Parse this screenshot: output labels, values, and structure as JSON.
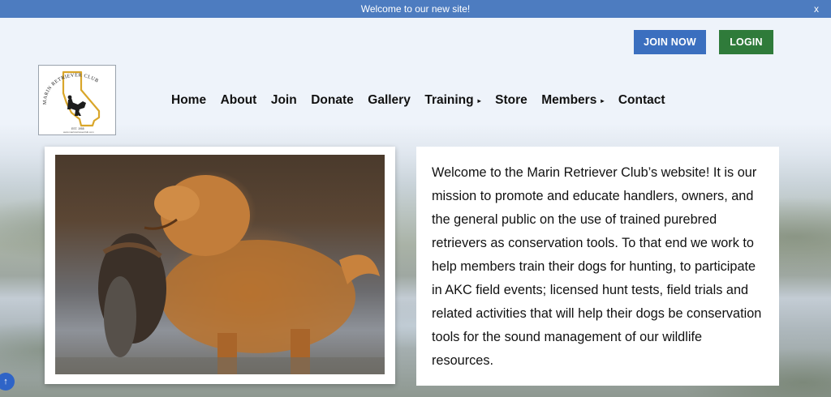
{
  "announcement": {
    "text": "Welcome to our new site!",
    "close": "x"
  },
  "header": {
    "join_label": "JOIN NOW",
    "login_label": "LOGIN",
    "logo": {
      "text": "MARIN RETRIEVER CLUB",
      "est": "EST. 1955",
      "url": "www.marinretrieverclub.com"
    }
  },
  "nav": {
    "items": [
      {
        "label": "Home"
      },
      {
        "label": "About"
      },
      {
        "label": "Join"
      },
      {
        "label": "Donate"
      },
      {
        "label": "Gallery"
      },
      {
        "label": "Training",
        "caret": "▸"
      },
      {
        "label": "Store"
      },
      {
        "label": "Members",
        "caret": "▸"
      },
      {
        "label": "Contact"
      }
    ]
  },
  "main": {
    "welcome_text": "Welcome to the Marin Retriever Club’s website! It is our mission to promote and educate handlers, owners, and the general public on the use of trained purebred retrievers as conservation tools. To that end we work to help members train their dogs for hunting, to participate in AKC field events; licensed hunt tests, field trials and related activities that will help their dogs be conservation tools for the sound management of our wildlife resources."
  },
  "colors": {
    "topbar": "#4d7cc0",
    "join": "#3b6fbf",
    "login": "#2f7b3a",
    "scroll": "#2f64c7"
  },
  "icons": {
    "scroll_top": "arrow-up-icon",
    "photo": "retriever-dog-photo"
  }
}
